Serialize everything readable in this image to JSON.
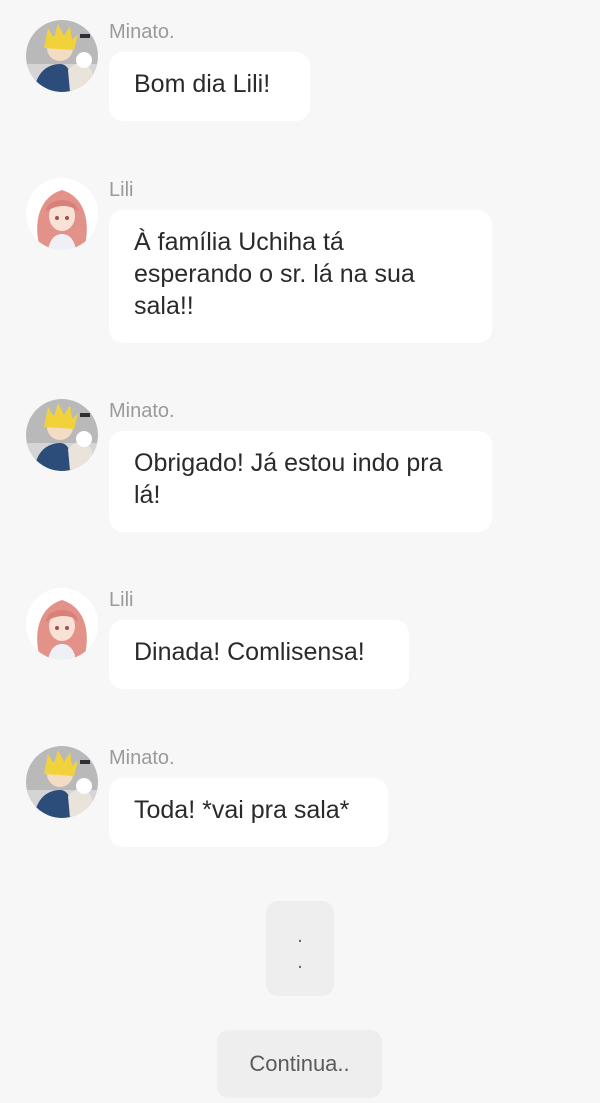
{
  "messages": [
    {
      "sender": "Minato.",
      "text": "Bom dia Lili!"
    },
    {
      "sender": "Lili",
      "text": "À família Uchiha tá esperando o sr. lá na sua sala!!"
    },
    {
      "sender": "Minato.",
      "text": "Obrigado! Já estou indo pra lá!"
    },
    {
      "sender": "Lili",
      "text": "Dinada! Comlisensa!"
    },
    {
      "sender": "Minato.",
      "text": "Toda! *vai pra sala*"
    }
  ],
  "avatars": {
    "minato": "minato-avatar",
    "lili": "lili-avatar"
  },
  "ellipsis": {
    "dot1": ".",
    "dot2": "."
  },
  "continue_button": {
    "label": "Continua.."
  },
  "colors": {
    "background": "#f7f7f7",
    "bubble": "#ffffff",
    "name": "#9a9a9a",
    "button": "#eeeeee"
  }
}
